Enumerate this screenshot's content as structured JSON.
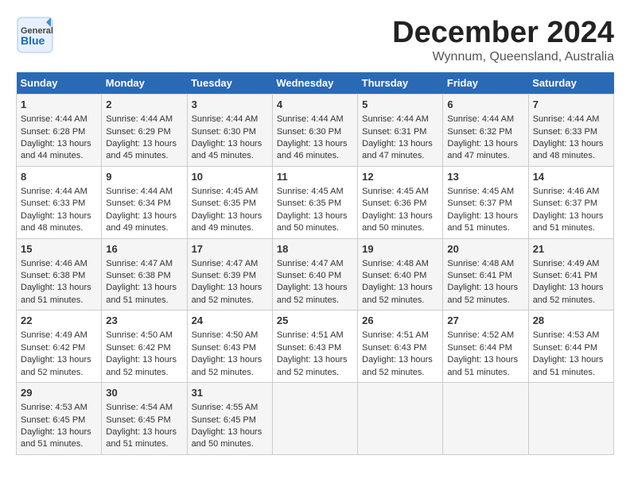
{
  "header": {
    "logo_general": "General",
    "logo_blue": "Blue",
    "month": "December 2024",
    "location": "Wynnum, Queensland, Australia"
  },
  "days_of_week": [
    "Sunday",
    "Monday",
    "Tuesday",
    "Wednesday",
    "Thursday",
    "Friday",
    "Saturday"
  ],
  "weeks": [
    [
      {
        "day": "1",
        "sunrise": "Sunrise: 4:44 AM",
        "sunset": "Sunset: 6:28 PM",
        "daylight": "Daylight: 13 hours and 44 minutes."
      },
      {
        "day": "2",
        "sunrise": "Sunrise: 4:44 AM",
        "sunset": "Sunset: 6:29 PM",
        "daylight": "Daylight: 13 hours and 45 minutes."
      },
      {
        "day": "3",
        "sunrise": "Sunrise: 4:44 AM",
        "sunset": "Sunset: 6:30 PM",
        "daylight": "Daylight: 13 hours and 45 minutes."
      },
      {
        "day": "4",
        "sunrise": "Sunrise: 4:44 AM",
        "sunset": "Sunset: 6:30 PM",
        "daylight": "Daylight: 13 hours and 46 minutes."
      },
      {
        "day": "5",
        "sunrise": "Sunrise: 4:44 AM",
        "sunset": "Sunset: 6:31 PM",
        "daylight": "Daylight: 13 hours and 47 minutes."
      },
      {
        "day": "6",
        "sunrise": "Sunrise: 4:44 AM",
        "sunset": "Sunset: 6:32 PM",
        "daylight": "Daylight: 13 hours and 47 minutes."
      },
      {
        "day": "7",
        "sunrise": "Sunrise: 4:44 AM",
        "sunset": "Sunset: 6:33 PM",
        "daylight": "Daylight: 13 hours and 48 minutes."
      }
    ],
    [
      {
        "day": "8",
        "sunrise": "Sunrise: 4:44 AM",
        "sunset": "Sunset: 6:33 PM",
        "daylight": "Daylight: 13 hours and 48 minutes."
      },
      {
        "day": "9",
        "sunrise": "Sunrise: 4:44 AM",
        "sunset": "Sunset: 6:34 PM",
        "daylight": "Daylight: 13 hours and 49 minutes."
      },
      {
        "day": "10",
        "sunrise": "Sunrise: 4:45 AM",
        "sunset": "Sunset: 6:35 PM",
        "daylight": "Daylight: 13 hours and 49 minutes."
      },
      {
        "day": "11",
        "sunrise": "Sunrise: 4:45 AM",
        "sunset": "Sunset: 6:35 PM",
        "daylight": "Daylight: 13 hours and 50 minutes."
      },
      {
        "day": "12",
        "sunrise": "Sunrise: 4:45 AM",
        "sunset": "Sunset: 6:36 PM",
        "daylight": "Daylight: 13 hours and 50 minutes."
      },
      {
        "day": "13",
        "sunrise": "Sunrise: 4:45 AM",
        "sunset": "Sunset: 6:37 PM",
        "daylight": "Daylight: 13 hours and 51 minutes."
      },
      {
        "day": "14",
        "sunrise": "Sunrise: 4:46 AM",
        "sunset": "Sunset: 6:37 PM",
        "daylight": "Daylight: 13 hours and 51 minutes."
      }
    ],
    [
      {
        "day": "15",
        "sunrise": "Sunrise: 4:46 AM",
        "sunset": "Sunset: 6:38 PM",
        "daylight": "Daylight: 13 hours and 51 minutes."
      },
      {
        "day": "16",
        "sunrise": "Sunrise: 4:47 AM",
        "sunset": "Sunset: 6:38 PM",
        "daylight": "Daylight: 13 hours and 51 minutes."
      },
      {
        "day": "17",
        "sunrise": "Sunrise: 4:47 AM",
        "sunset": "Sunset: 6:39 PM",
        "daylight": "Daylight: 13 hours and 52 minutes."
      },
      {
        "day": "18",
        "sunrise": "Sunrise: 4:47 AM",
        "sunset": "Sunset: 6:40 PM",
        "daylight": "Daylight: 13 hours and 52 minutes."
      },
      {
        "day": "19",
        "sunrise": "Sunrise: 4:48 AM",
        "sunset": "Sunset: 6:40 PM",
        "daylight": "Daylight: 13 hours and 52 minutes."
      },
      {
        "day": "20",
        "sunrise": "Sunrise: 4:48 AM",
        "sunset": "Sunset: 6:41 PM",
        "daylight": "Daylight: 13 hours and 52 minutes."
      },
      {
        "day": "21",
        "sunrise": "Sunrise: 4:49 AM",
        "sunset": "Sunset: 6:41 PM",
        "daylight": "Daylight: 13 hours and 52 minutes."
      }
    ],
    [
      {
        "day": "22",
        "sunrise": "Sunrise: 4:49 AM",
        "sunset": "Sunset: 6:42 PM",
        "daylight": "Daylight: 13 hours and 52 minutes."
      },
      {
        "day": "23",
        "sunrise": "Sunrise: 4:50 AM",
        "sunset": "Sunset: 6:42 PM",
        "daylight": "Daylight: 13 hours and 52 minutes."
      },
      {
        "day": "24",
        "sunrise": "Sunrise: 4:50 AM",
        "sunset": "Sunset: 6:43 PM",
        "daylight": "Daylight: 13 hours and 52 minutes."
      },
      {
        "day": "25",
        "sunrise": "Sunrise: 4:51 AM",
        "sunset": "Sunset: 6:43 PM",
        "daylight": "Daylight: 13 hours and 52 minutes."
      },
      {
        "day": "26",
        "sunrise": "Sunrise: 4:51 AM",
        "sunset": "Sunset: 6:43 PM",
        "daylight": "Daylight: 13 hours and 52 minutes."
      },
      {
        "day": "27",
        "sunrise": "Sunrise: 4:52 AM",
        "sunset": "Sunset: 6:44 PM",
        "daylight": "Daylight: 13 hours and 51 minutes."
      },
      {
        "day": "28",
        "sunrise": "Sunrise: 4:53 AM",
        "sunset": "Sunset: 6:44 PM",
        "daylight": "Daylight: 13 hours and 51 minutes."
      }
    ],
    [
      {
        "day": "29",
        "sunrise": "Sunrise: 4:53 AM",
        "sunset": "Sunset: 6:45 PM",
        "daylight": "Daylight: 13 hours and 51 minutes."
      },
      {
        "day": "30",
        "sunrise": "Sunrise: 4:54 AM",
        "sunset": "Sunset: 6:45 PM",
        "daylight": "Daylight: 13 hours and 51 minutes."
      },
      {
        "day": "31",
        "sunrise": "Sunrise: 4:55 AM",
        "sunset": "Sunset: 6:45 PM",
        "daylight": "Daylight: 13 hours and 50 minutes."
      },
      null,
      null,
      null,
      null
    ]
  ]
}
